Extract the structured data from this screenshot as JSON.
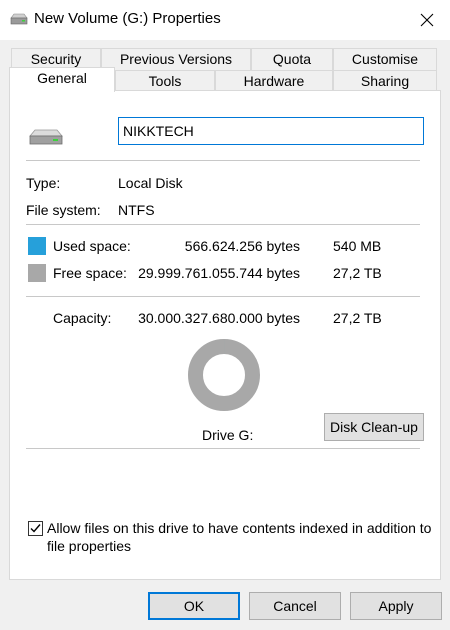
{
  "window": {
    "title": "New Volume (G:) Properties"
  },
  "tabs_back": [
    "Security",
    "Previous Versions",
    "Quota",
    "Customise"
  ],
  "tabs_front": [
    "General",
    "Tools",
    "Hardware",
    "Sharing"
  ],
  "general": {
    "volume_name": "NIKKTECH",
    "type_label": "Type:",
    "type_value": "Local Disk",
    "fs_label": "File system:",
    "fs_value": "NTFS",
    "used_label": "Used space:",
    "used_bytes": "566.624.256 bytes",
    "used_size": "540 MB",
    "used_color": "#26a0da",
    "free_label": "Free space:",
    "free_bytes": "29.999.761.055.744 bytes",
    "free_size": "27,2 TB",
    "free_color": "#a8a8a8",
    "capacity_label": "Capacity:",
    "capacity_bytes": "30.000.327.680.000 bytes",
    "capacity_size": "27,2 TB",
    "drive_label": "Drive G:",
    "cleanup_label": "Disk Clean-up",
    "index_checkbox_label_line1": "Allow files on this drive to have contents indexed in addition to",
    "index_checkbox_label_line2": "file properties",
    "index_checked": true
  },
  "buttons": {
    "ok": "OK",
    "cancel": "Cancel",
    "apply": "Apply"
  },
  "icons": {
    "title": "drive-icon",
    "close": "close-icon",
    "drive": "drive-icon",
    "check": "checkmark-icon"
  }
}
